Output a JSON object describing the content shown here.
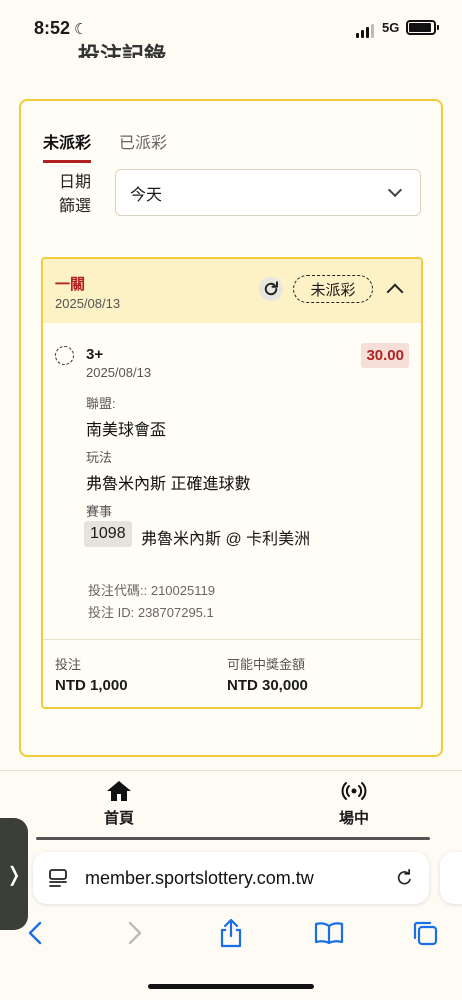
{
  "status_bar": {
    "time": "8:52",
    "network": "5G",
    "battery_level": 0.9
  },
  "page": {
    "title_cut": "投注記錄"
  },
  "tabs": [
    {
      "label": "未派彩",
      "active": true
    },
    {
      "label": "已派彩",
      "active": false
    }
  ],
  "filter": {
    "label": "日期篩選",
    "selected": "今天"
  },
  "bet": {
    "type": "一關",
    "date": "2025/08/13",
    "status": "未派彩",
    "selection": "3+",
    "selection_date": "2025/08/13",
    "odds": "30.00",
    "league_label": "聯盟:",
    "league": "南美球會盃",
    "market_label": "玩法",
    "market": "弗魯米內斯 正確進球數",
    "event_label": "賽事",
    "event_id": "1098",
    "event_name": "弗魯米內斯 @ 卡利美洲",
    "bet_code": "投注代碼:: 210025119",
    "bet_id": "投注 ID: 238707295.1",
    "stake_label": "投注",
    "stake": "NTD 1,000",
    "payout_label": "可能中獎金額",
    "payout": "NTD 30,000"
  },
  "bottom_nav": [
    {
      "label": "首頁",
      "icon": "home-icon"
    },
    {
      "label": "場中",
      "icon": "live-broadcast-icon"
    }
  ],
  "browser": {
    "url": "member.sportslottery.com.tw"
  },
  "colors": {
    "accent": "#b22222",
    "border": "#f1cd3a",
    "header_bg": "#fdf1c6"
  }
}
